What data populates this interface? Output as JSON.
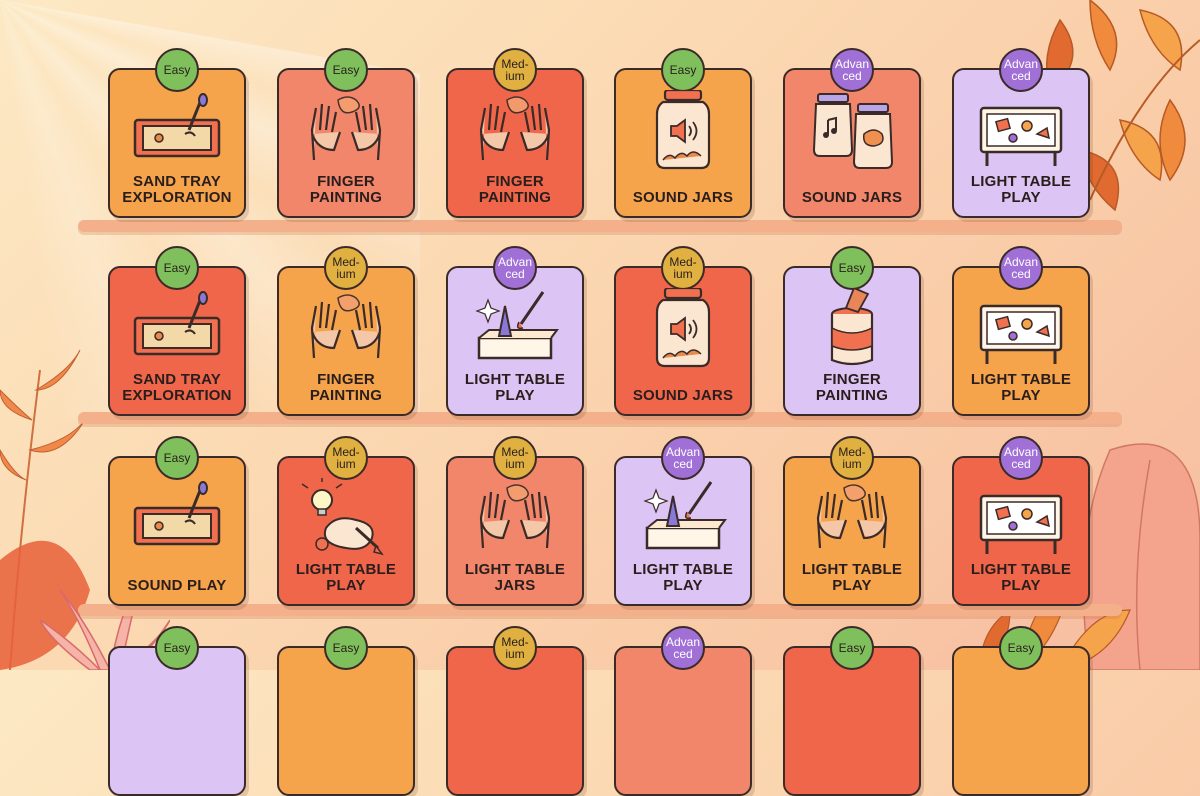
{
  "colors": {
    "easy": "#7fbf5c",
    "medium": "#e0b040",
    "advanced": "#a070d6",
    "orange": "#f6a44c",
    "salmon": "#f2866a",
    "red": "#f0664a",
    "lilac": "#dcc4f4"
  },
  "rows": [
    [
      {
        "badge": "Easy",
        "level": "easy",
        "color": "orange",
        "icon": "sandtray",
        "label": "SAND TRAY EXPLORATION"
      },
      {
        "badge": "Easy",
        "level": "easy",
        "color": "salmon",
        "icon": "hands",
        "label": "FINGER PAINTING"
      },
      {
        "badge": "Med-ium",
        "level": "medium",
        "color": "red",
        "icon": "hands",
        "label": "FINGER PAINTING"
      },
      {
        "badge": "Easy",
        "level": "easy",
        "color": "orange",
        "icon": "jar",
        "label": "SOUND JARS"
      },
      {
        "badge": "Advan ced",
        "level": "advanced",
        "color": "salmon",
        "icon": "jars",
        "label": "SOUND JARS"
      },
      {
        "badge": "Advan ced",
        "level": "advanced",
        "color": "lilac",
        "icon": "lighttable",
        "label": "LIGHT TABLE PLAY"
      }
    ],
    [
      {
        "badge": "Easy",
        "level": "easy",
        "color": "red",
        "icon": "sandtray",
        "label": "SAND TRAY EXPLORATION"
      },
      {
        "badge": "Med-ium",
        "level": "medium",
        "color": "orange",
        "icon": "hands",
        "label": "FINGER PAINTING"
      },
      {
        "badge": "Advan ced",
        "level": "advanced",
        "color": "lilac",
        "icon": "box",
        "label": "LIGHT TABLE PLAY"
      },
      {
        "badge": "Med-ium",
        "level": "medium",
        "color": "red",
        "icon": "jar",
        "label": "SOUND JARS"
      },
      {
        "badge": "Easy",
        "level": "easy",
        "color": "lilac",
        "icon": "can",
        "label": "FINGER PAINTING"
      },
      {
        "badge": "Advan ced",
        "level": "advanced",
        "color": "orange",
        "icon": "lighttable",
        "label": "LIGHT TABLE PLAY"
      }
    ],
    [
      {
        "badge": "Easy",
        "level": "easy",
        "color": "orange",
        "icon": "sandtray",
        "label": "SOUND PLAY"
      },
      {
        "badge": "Med-ium",
        "level": "medium",
        "color": "red",
        "icon": "bulb",
        "label": "LIGHT TABLE PLAY"
      },
      {
        "badge": "Med-ium",
        "level": "medium",
        "color": "salmon",
        "icon": "hands",
        "label": "LIGHT TABLE JARS"
      },
      {
        "badge": "Advan ced",
        "level": "advanced",
        "color": "lilac",
        "icon": "box",
        "label": "LIGHT TABLE PLAY"
      },
      {
        "badge": "Med-ium",
        "level": "medium",
        "color": "orange",
        "icon": "hands",
        "label": "LIGHT TABLE PLAY"
      },
      {
        "badge": "Advan ced",
        "level": "advanced",
        "color": "red",
        "icon": "lighttable",
        "label": "LIGHT TABLE PLAY"
      }
    ],
    [
      {
        "badge": "Easy",
        "level": "easy",
        "color": "lilac",
        "icon": "none",
        "label": ""
      },
      {
        "badge": "Easy",
        "level": "easy",
        "color": "orange",
        "icon": "none",
        "label": ""
      },
      {
        "badge": "Med-ium",
        "level": "medium",
        "color": "red",
        "icon": "none",
        "label": ""
      },
      {
        "badge": "Advan ced",
        "level": "advanced",
        "color": "salmon",
        "icon": "none",
        "label": ""
      },
      {
        "badge": "Easy",
        "level": "easy",
        "color": "red",
        "icon": "none",
        "label": ""
      },
      {
        "badge": "Easy",
        "level": "easy",
        "color": "orange",
        "icon": "none",
        "label": ""
      }
    ]
  ]
}
